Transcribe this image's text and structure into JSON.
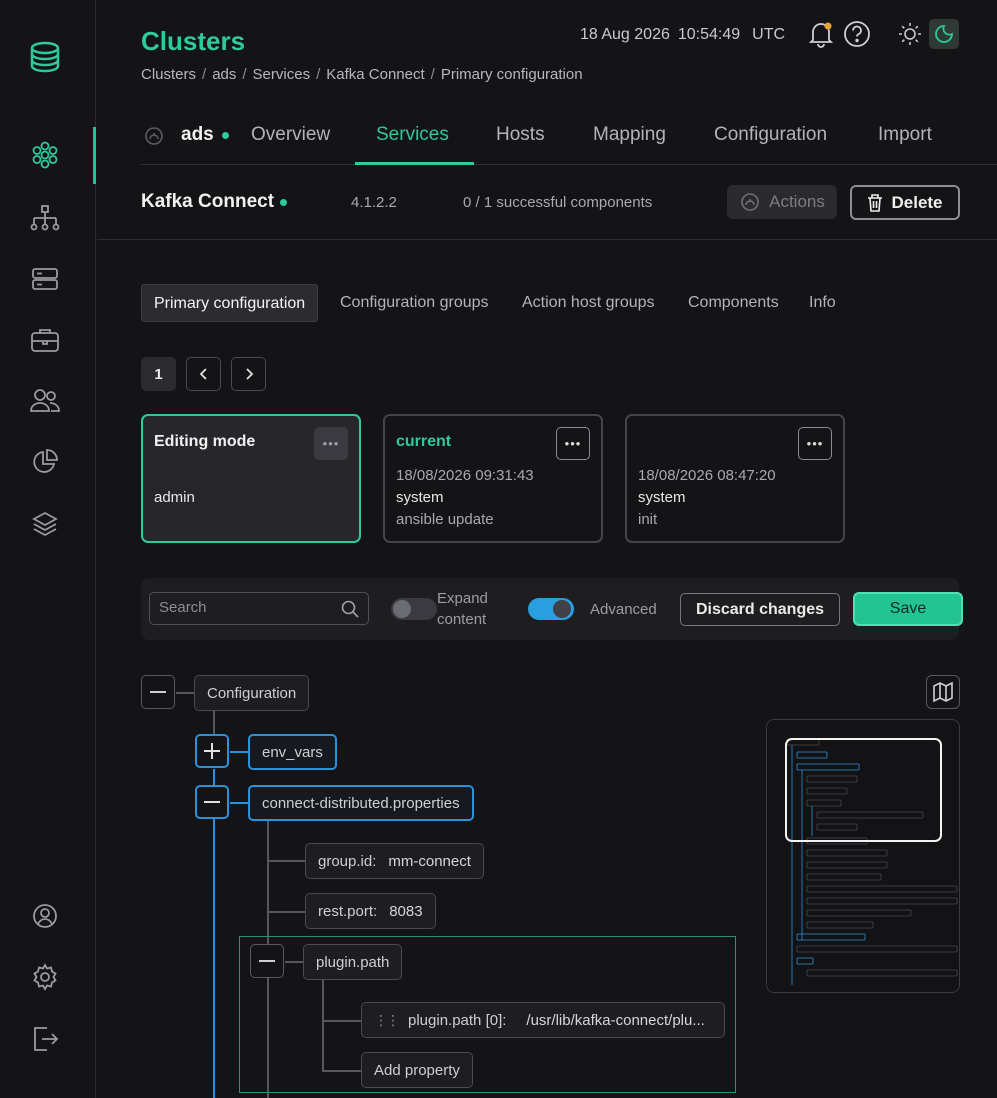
{
  "header": {
    "title": "Clusters",
    "breadcrumb": [
      "Clusters",
      "ads",
      "Services",
      "Kafka Connect",
      "Primary configuration"
    ],
    "date": "18 Aug 2026",
    "time": "10:54:49",
    "timezone": "UTC"
  },
  "cluster_tabs": {
    "cluster_name": "ads",
    "items": [
      "Overview",
      "Services",
      "Hosts",
      "Mapping",
      "Configuration",
      "Import"
    ],
    "active": "Services"
  },
  "service": {
    "name": "Kafka Connect",
    "version": "4.1.2.2",
    "components_status": "0 / 1 successful components",
    "actions_label": "Actions",
    "delete_label": "Delete"
  },
  "subtabs": {
    "items": [
      "Primary configuration",
      "Configuration groups",
      "Action host groups",
      "Components",
      "Info"
    ],
    "active": "Primary configuration"
  },
  "pager": {
    "page": "1"
  },
  "config_cards": [
    {
      "title": "Editing mode",
      "user": "admin",
      "date": "",
      "description": ""
    },
    {
      "title": "current",
      "date": "18/08/2026 09:31:43",
      "user": "system",
      "description": "ansible update"
    },
    {
      "title": "",
      "date": "18/08/2026 08:47:20",
      "user": "system",
      "description": "init"
    }
  ],
  "toolbar": {
    "search_placeholder": "Search",
    "expand_label_1": "Expand",
    "expand_label_2": "content",
    "expand_on": false,
    "advanced_label": "Advanced",
    "advanced_on": true,
    "discard_label": "Discard changes",
    "save_label": "Save"
  },
  "tree": {
    "root": "Configuration",
    "env_vars": "env_vars",
    "section": "connect-distributed.properties",
    "group_id_key": "group.id:",
    "group_id_value": "mm-connect",
    "rest_port_key": "rest.port:",
    "rest_port_value": "8083",
    "plugin_path": "plugin.path",
    "plugin_item_key": "plugin.path [0]:",
    "plugin_item_value": "/usr/lib/kafka-connect/plu...",
    "add_property": "Add property"
  },
  "colors": {
    "accent": "#2fc99a",
    "info_blue": "#2c91db",
    "background": "#141416"
  }
}
